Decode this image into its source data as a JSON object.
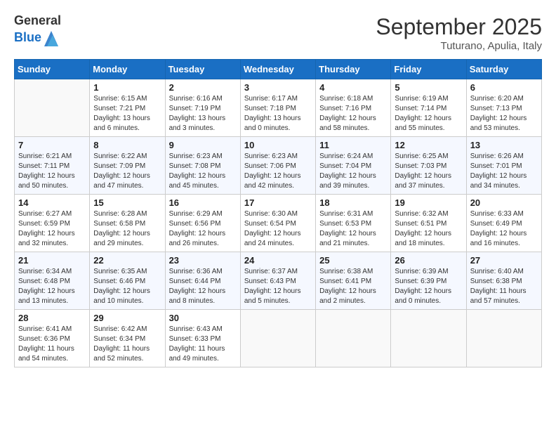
{
  "header": {
    "logo_general": "General",
    "logo_blue": "Blue",
    "month_title": "September 2025",
    "location": "Tuturano, Apulia, Italy"
  },
  "days_of_week": [
    "Sunday",
    "Monday",
    "Tuesday",
    "Wednesday",
    "Thursday",
    "Friday",
    "Saturday"
  ],
  "weeks": [
    [
      {
        "day": "",
        "info": ""
      },
      {
        "day": "1",
        "info": "Sunrise: 6:15 AM\nSunset: 7:21 PM\nDaylight: 13 hours\nand 6 minutes."
      },
      {
        "day": "2",
        "info": "Sunrise: 6:16 AM\nSunset: 7:19 PM\nDaylight: 13 hours\nand 3 minutes."
      },
      {
        "day": "3",
        "info": "Sunrise: 6:17 AM\nSunset: 7:18 PM\nDaylight: 13 hours\nand 0 minutes."
      },
      {
        "day": "4",
        "info": "Sunrise: 6:18 AM\nSunset: 7:16 PM\nDaylight: 12 hours\nand 58 minutes."
      },
      {
        "day": "5",
        "info": "Sunrise: 6:19 AM\nSunset: 7:14 PM\nDaylight: 12 hours\nand 55 minutes."
      },
      {
        "day": "6",
        "info": "Sunrise: 6:20 AM\nSunset: 7:13 PM\nDaylight: 12 hours\nand 53 minutes."
      }
    ],
    [
      {
        "day": "7",
        "info": "Sunrise: 6:21 AM\nSunset: 7:11 PM\nDaylight: 12 hours\nand 50 minutes."
      },
      {
        "day": "8",
        "info": "Sunrise: 6:22 AM\nSunset: 7:09 PM\nDaylight: 12 hours\nand 47 minutes."
      },
      {
        "day": "9",
        "info": "Sunrise: 6:23 AM\nSunset: 7:08 PM\nDaylight: 12 hours\nand 45 minutes."
      },
      {
        "day": "10",
        "info": "Sunrise: 6:23 AM\nSunset: 7:06 PM\nDaylight: 12 hours\nand 42 minutes."
      },
      {
        "day": "11",
        "info": "Sunrise: 6:24 AM\nSunset: 7:04 PM\nDaylight: 12 hours\nand 39 minutes."
      },
      {
        "day": "12",
        "info": "Sunrise: 6:25 AM\nSunset: 7:03 PM\nDaylight: 12 hours\nand 37 minutes."
      },
      {
        "day": "13",
        "info": "Sunrise: 6:26 AM\nSunset: 7:01 PM\nDaylight: 12 hours\nand 34 minutes."
      }
    ],
    [
      {
        "day": "14",
        "info": "Sunrise: 6:27 AM\nSunset: 6:59 PM\nDaylight: 12 hours\nand 32 minutes."
      },
      {
        "day": "15",
        "info": "Sunrise: 6:28 AM\nSunset: 6:58 PM\nDaylight: 12 hours\nand 29 minutes."
      },
      {
        "day": "16",
        "info": "Sunrise: 6:29 AM\nSunset: 6:56 PM\nDaylight: 12 hours\nand 26 minutes."
      },
      {
        "day": "17",
        "info": "Sunrise: 6:30 AM\nSunset: 6:54 PM\nDaylight: 12 hours\nand 24 minutes."
      },
      {
        "day": "18",
        "info": "Sunrise: 6:31 AM\nSunset: 6:53 PM\nDaylight: 12 hours\nand 21 minutes."
      },
      {
        "day": "19",
        "info": "Sunrise: 6:32 AM\nSunset: 6:51 PM\nDaylight: 12 hours\nand 18 minutes."
      },
      {
        "day": "20",
        "info": "Sunrise: 6:33 AM\nSunset: 6:49 PM\nDaylight: 12 hours\nand 16 minutes."
      }
    ],
    [
      {
        "day": "21",
        "info": "Sunrise: 6:34 AM\nSunset: 6:48 PM\nDaylight: 12 hours\nand 13 minutes."
      },
      {
        "day": "22",
        "info": "Sunrise: 6:35 AM\nSunset: 6:46 PM\nDaylight: 12 hours\nand 10 minutes."
      },
      {
        "day": "23",
        "info": "Sunrise: 6:36 AM\nSunset: 6:44 PM\nDaylight: 12 hours\nand 8 minutes."
      },
      {
        "day": "24",
        "info": "Sunrise: 6:37 AM\nSunset: 6:43 PM\nDaylight: 12 hours\nand 5 minutes."
      },
      {
        "day": "25",
        "info": "Sunrise: 6:38 AM\nSunset: 6:41 PM\nDaylight: 12 hours\nand 2 minutes."
      },
      {
        "day": "26",
        "info": "Sunrise: 6:39 AM\nSunset: 6:39 PM\nDaylight: 12 hours\nand 0 minutes."
      },
      {
        "day": "27",
        "info": "Sunrise: 6:40 AM\nSunset: 6:38 PM\nDaylight: 11 hours\nand 57 minutes."
      }
    ],
    [
      {
        "day": "28",
        "info": "Sunrise: 6:41 AM\nSunset: 6:36 PM\nDaylight: 11 hours\nand 54 minutes."
      },
      {
        "day": "29",
        "info": "Sunrise: 6:42 AM\nSunset: 6:34 PM\nDaylight: 11 hours\nand 52 minutes."
      },
      {
        "day": "30",
        "info": "Sunrise: 6:43 AM\nSunset: 6:33 PM\nDaylight: 11 hours\nand 49 minutes."
      },
      {
        "day": "",
        "info": ""
      },
      {
        "day": "",
        "info": ""
      },
      {
        "day": "",
        "info": ""
      },
      {
        "day": "",
        "info": ""
      }
    ]
  ]
}
